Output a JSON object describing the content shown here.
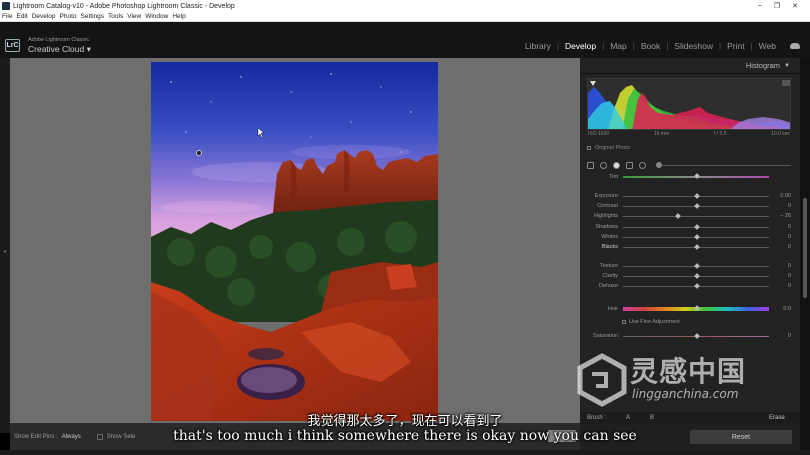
{
  "window": {
    "title": "Lightroom Catalog-v10 - Adobe Photoshop Lightroom Classic - Develop",
    "controls": [
      "–",
      "❐",
      "✕"
    ]
  },
  "menu": [
    "File",
    "Edit",
    "Develop",
    "Photo",
    "Settings",
    "Tools",
    "View",
    "Window",
    "Help"
  ],
  "brand": {
    "logo": "LrC",
    "line1": "Adobe Lightroom Classic",
    "line2": "Creative Cloud"
  },
  "modules": [
    "Library",
    "Develop",
    "Map",
    "Book",
    "Slideshow",
    "Print",
    "Web"
  ],
  "active_module": "Develop",
  "toolbar": {
    "pins_label": "Show Edit Pins :",
    "pins_value": "Always",
    "show_selected_label": "Show Sele"
  },
  "panel": {
    "histogram_title": "Histogram",
    "exif": [
      "ISO 1600",
      "16 mm",
      "f / 3.5",
      "10.0 sec"
    ],
    "original_photo": "Original Photo",
    "sliders": [
      {
        "name": "Tint",
        "value": "",
        "pos": 0.5
      },
      {
        "name": "Exposure",
        "value": "0.00",
        "pos": 0.5
      },
      {
        "name": "Contrast",
        "value": "0",
        "pos": 0.5
      },
      {
        "name": "Highlights",
        "value": "– 26",
        "pos": 0.37
      },
      {
        "name": "Shadows",
        "value": "0",
        "pos": 0.5
      },
      {
        "name": "Whites",
        "value": "0",
        "pos": 0.5
      },
      {
        "name": "Blacks",
        "value": "0",
        "pos": 0.5
      },
      {
        "name": "Texture",
        "value": "0",
        "pos": 0.5
      },
      {
        "name": "Clarity",
        "value": "0",
        "pos": 0.5
      },
      {
        "name": "Dehaze",
        "value": "0",
        "pos": 0.5
      },
      {
        "name": "Hue",
        "value": "0.0",
        "pos": 0.5
      },
      {
        "name": "Saturation",
        "value": "0",
        "pos": 0.5
      }
    ],
    "fine_adjustment": "Use Fine Adjustment",
    "brush_label": "Brush :",
    "brush_a": "A",
    "brush_b": "B",
    "erase": "Erase",
    "reset": "Reset"
  },
  "subtitles": {
    "chinese": "我觉得那太多了，现在可以看到了",
    "english": "that's too much i think somewhere there is okay now you can see"
  },
  "watermark": {
    "chinese": "灵感中国",
    "english": "lingganchina.com"
  },
  "colors": {
    "sky_top": "#1a2fa8",
    "sky_mid": "#5a5fd0",
    "horizon": "#c89ad8",
    "rock": "#b83a1a",
    "active_module": "#ffffff"
  }
}
